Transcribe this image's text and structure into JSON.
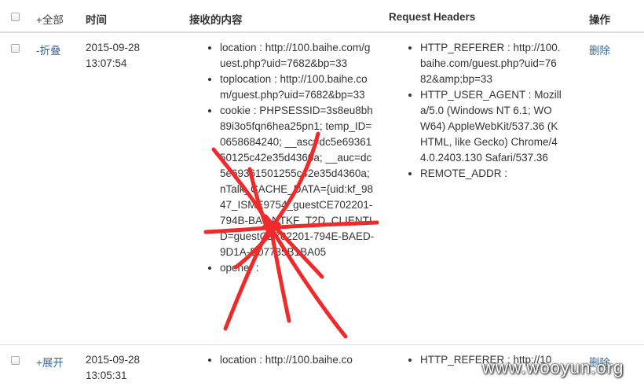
{
  "header": {
    "select_all_label": "+全部",
    "time": "时间",
    "content": "接收的内容",
    "request_headers": "Request Headers",
    "actions": "操作"
  },
  "rows": [
    {
      "toggle": "-折叠",
      "date": "2015-09-28",
      "time": "13:07:54",
      "content": [
        "location : http://100.baihe.com/guest.php?uid=7682&bp=33",
        "toplocation : http://100.baihe.com/guest.php?uid=7682&bp=33",
        "cookie : PHPSESSID=3s8eu8bh89i3o5fqn6hea25pn1; temp_ID=0658684240; __asc=dc5e6936150125c42e35d4360a; __auc=dc5e69361501255c42e35d4360a; nTalk_CACHE_DATA={uid:kf_9847_ISME9754_guestCE702201-794B-BA}; NTKF_T2D_CLIENTID=guestCE702201-794E-BAED-9D1A-D07735B1BA05",
        "opener :"
      ],
      "headers": [
        "HTTP_REFERER : http://100.baihe.com/guest.php?uid=7682&amp;bp=33",
        "HTTP_USER_AGENT : Mozilla/5.0 (Windows NT 6.1; WOW64) AppleWebKit/537.36 (KHTML, like Gecko) Chrome/44.0.2403.130 Safari/537.36",
        "REMOTE_ADDR :"
      ],
      "delete": "删除"
    },
    {
      "toggle": "+展开",
      "date": "2015-09-28",
      "time": "13:05:31",
      "content": [
        "location : http://100.baihe.co"
      ],
      "headers": [
        "HTTP_REFERER : http://10"
      ],
      "delete": "删除"
    }
  ],
  "watermark": "www.wooyun.org",
  "colors": {
    "link": "#3c6a98",
    "scribble": "#ee2a2a",
    "border": "#dddddd"
  }
}
